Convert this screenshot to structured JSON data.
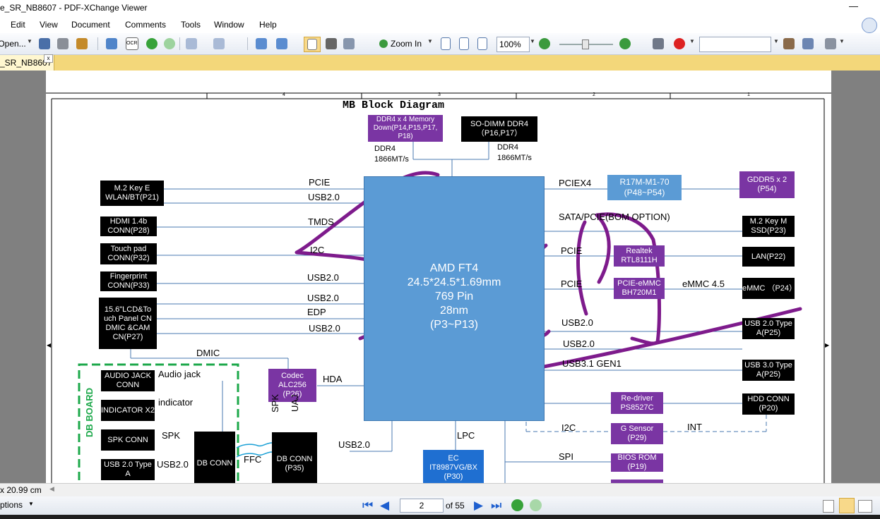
{
  "window": {
    "title": "e_SR_NB8607 - PDF-XChange Viewer",
    "minimize_glyph": "—"
  },
  "menu": [
    "Edit",
    "View",
    "Document",
    "Comments",
    "Tools",
    "Window",
    "Help"
  ],
  "toolbar": {
    "open_label": "Open...",
    "zoom_in_label": "Zoom In",
    "zoom_value": "100%",
    "search_value": "",
    "icons": [
      "save-icon",
      "print-icon",
      "attach-icon",
      "email-icon",
      "ocr-icon",
      "back-icon",
      "forward-icon",
      "undo-icon",
      "redo-icon",
      "copy-icon",
      "paste-icon",
      "hand-icon",
      "snapshot-icon",
      "select-text-icon",
      "zoom-in-icon",
      "actual-size-icon",
      "fit-page-icon",
      "fit-width-icon",
      "zoom-out-icon",
      "zoom-plus-icon",
      "find-icon",
      "stamp-icon",
      "highlight-icon",
      "sign-icon",
      "tools-icon"
    ],
    "accent": "#3a6fc4"
  },
  "tab": {
    "label": "_SR_NB8607",
    "close": "x"
  },
  "status": {
    "dimensions": "x 20.99 cm",
    "options": "ptions"
  },
  "nav": {
    "page_current": "2",
    "page_total": "of 55"
  },
  "diagram": {
    "title": "MB Block Diagram",
    "ruler_numbers": [
      "4",
      "3",
      "2",
      "1"
    ],
    "cpu": {
      "lines": [
        "AMD FT4",
        "24.5*24.5*1.69mm",
        "769 Pin",
        "28nm",
        "(P3~P13)"
      ]
    },
    "memory": [
      {
        "text": "DDR4 x 4 Memory Down(P14,P15,P17, P18)",
        "speed": "DDR4 1866MT/s"
      },
      {
        "text": "SO-DIMM DDR4 （P16,P17）",
        "speed": "DDR4 1866MT/s"
      }
    ],
    "left_boxes": [
      "M.2 Key E WLAN/BT(P21)",
      "HDMI 1.4b CONN(P28)",
      "Touch pad CONN(P32)",
      "Fingerprint CONN(P33)",
      "15.6\"LCD&To uch Panel CN DMIC &CAM CN(P27)"
    ],
    "left_signals": [
      "PCIE",
      "USB2.0",
      "TMDS",
      "I2C",
      "USB2.0",
      "USB2.0",
      "EDP",
      "USB2.0"
    ],
    "right_boxes": [
      "GDDR5 x 2 (P54)",
      "M.2 Key M SSD(P23)",
      "LAN(P22)",
      "eMMC （P24）",
      "USB 2.0 Type A(P25)",
      "USB 3.0 Type A(P25)",
      "HDD CONN (P20)"
    ],
    "right_signals": [
      "PCIEX4",
      "SATA/PCIE(BOM OPTION)",
      "PCIE",
      "PCIE",
      "USB2.0",
      "USB2.0",
      "USB3.1 GEN1",
      "eMMC 4.5",
      "I2C",
      "INT",
      "SPI"
    ],
    "gpu": "R17M-M1-70 (P48~P54)",
    "realtek": "Realtek RTL8111H",
    "pcie_emmc": "PCIE-eMMC BH720M1",
    "redriver": "Re-driver PS8527C",
    "gsensor": "G Sensor (P29)",
    "bios": "BIOS ROM (P19)",
    "codec": "Codec ALC256 (P26)",
    "ec": "EC IT8987VG/BX (P30)",
    "db_board": "DB BOARD",
    "db_boxes": [
      "AUDIO JACK CONN",
      "INDICATOR X2",
      "SPK CONN",
      "USB 2.0 Type A"
    ],
    "db_signals": [
      "Audio jack",
      "indicator",
      "SPK",
      "USB2.0"
    ],
    "dbconn1": "DB CONN",
    "dbconn2": "DB CONN (P35)",
    "misc": [
      "DMIC",
      "HDA",
      "SPK",
      "UAJ",
      "FFC",
      "USB2.0",
      "LPC"
    ],
    "colors": {
      "cpu": "#5b9bd5",
      "purple": "#7a35a3",
      "ink": "#7e1b8c",
      "dashed": "#1ca84a"
    }
  }
}
